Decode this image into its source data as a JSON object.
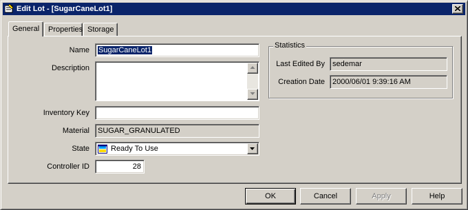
{
  "window": {
    "title": "Edit Lot - [SugarCaneLot1]"
  },
  "tabs": [
    {
      "label": "General",
      "active": true
    },
    {
      "label": "Properties",
      "active": false
    },
    {
      "label": "Storage",
      "active": false
    }
  ],
  "form": {
    "name": {
      "label": "Name",
      "value": "SugarCaneLot1"
    },
    "description": {
      "label": "Description",
      "value": ""
    },
    "inventory_key": {
      "label": "Inventory Key",
      "value": ""
    },
    "material": {
      "label": "Material",
      "value": "SUGAR_GRANULATED"
    },
    "state": {
      "label": "State",
      "value": "Ready To Use"
    },
    "controller_id": {
      "label": "Controller ID",
      "value": "28"
    }
  },
  "statistics": {
    "title": "Statistics",
    "last_edited_by": {
      "label": "Last Edited By",
      "value": "sedemar"
    },
    "creation_date": {
      "label": "Creation Date",
      "value": "2000/06/01 9:39:16 AM"
    }
  },
  "buttons": {
    "ok": "OK",
    "cancel": "Cancel",
    "apply": "Apply",
    "help": "Help"
  },
  "colors": {
    "titlebar": "#0a246a",
    "face": "#d4d0c8",
    "selection": "#0a246a"
  }
}
